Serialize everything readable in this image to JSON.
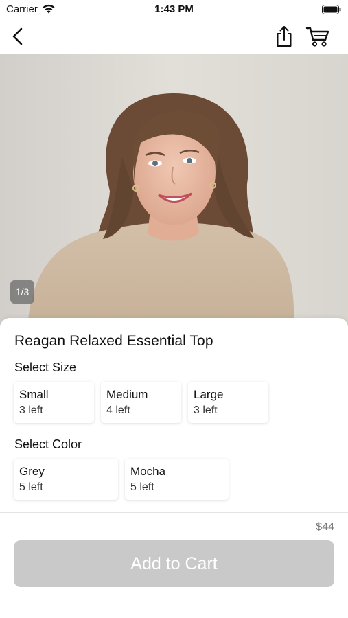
{
  "status_bar": {
    "carrier": "Carrier",
    "time": "1:43 PM"
  },
  "nav": {
    "icons": [
      "back-chevron-icon",
      "share-icon",
      "cart-icon"
    ]
  },
  "gallery": {
    "counter": "1/3",
    "current_index": 1,
    "total_images": 3
  },
  "product": {
    "title": "Reagan Relaxed Essential Top",
    "size_label": "Select Size",
    "sizes": [
      {
        "name": "Small",
        "stock": "3 left"
      },
      {
        "name": "Medium",
        "stock": "4 left"
      },
      {
        "name": "Large",
        "stock": "3 left"
      }
    ],
    "color_label": "Select Color",
    "colors": [
      {
        "name": "Grey",
        "stock": "5 left"
      },
      {
        "name": "Mocha",
        "stock": "5 left"
      }
    ],
    "price": "$44"
  },
  "actions": {
    "add_to_cart": "Add to Cart",
    "add_to_cart_enabled": false
  },
  "theme": {
    "disabled_button": "#c9c9c9",
    "background": "#ffffff",
    "text": "#111111"
  }
}
